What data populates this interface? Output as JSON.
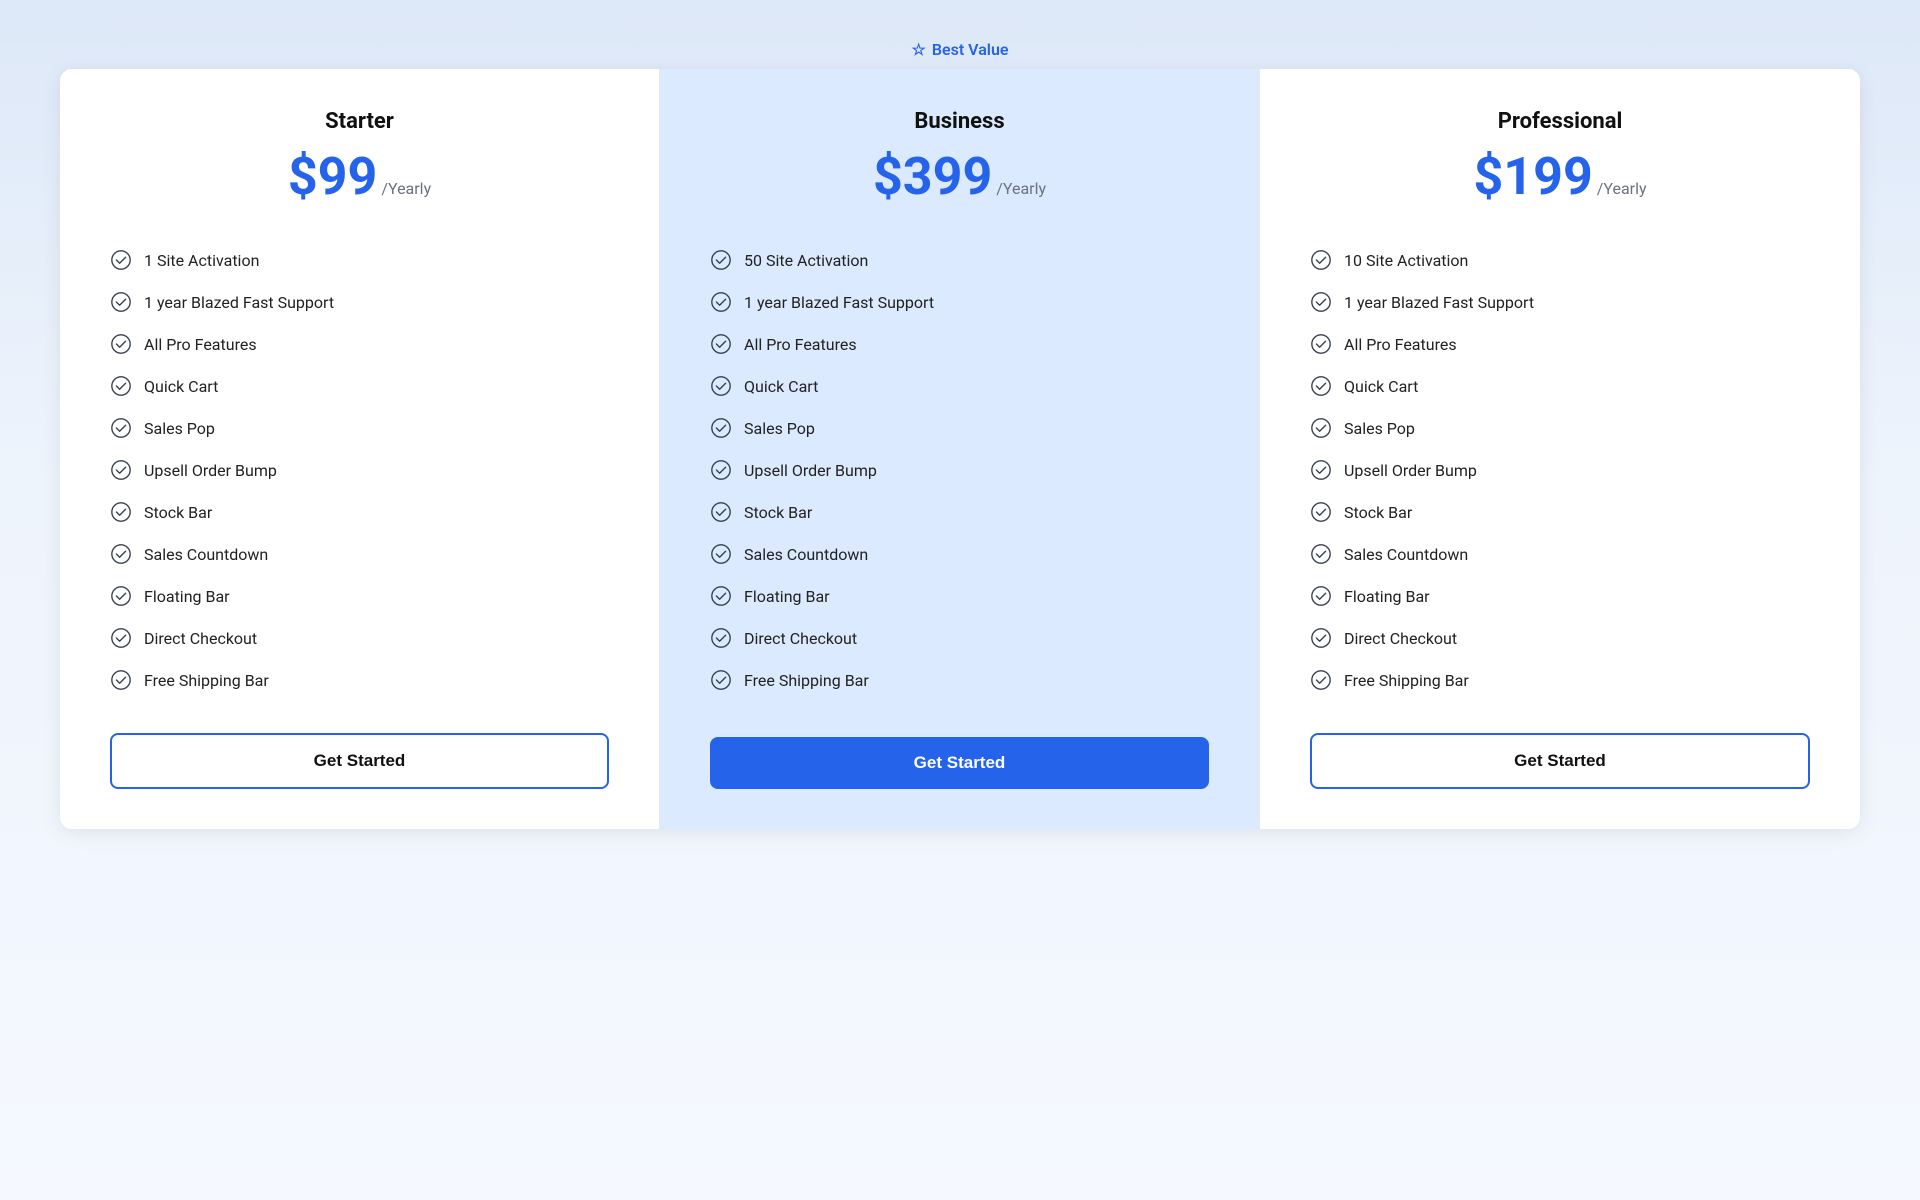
{
  "badge": {
    "label": "Best Value",
    "star": "☆"
  },
  "plans": [
    {
      "id": "starter",
      "name": "Starter",
      "price": "$99",
      "period": "/Yearly",
      "featured": false,
      "cta": "Get Started",
      "cta_style": "outline",
      "features": [
        "1 Site Activation",
        "1 year Blazed Fast Support",
        "All Pro Features",
        "Quick Cart",
        "Sales Pop",
        "Upsell Order Bump",
        "Stock Bar",
        "Sales Countdown",
        "Floating Bar",
        "Direct Checkout",
        "Free Shipping Bar"
      ]
    },
    {
      "id": "business",
      "name": "Business",
      "price": "$399",
      "period": "/Yearly",
      "featured": true,
      "cta": "Get Started",
      "cta_style": "filled",
      "features": [
        "50 Site Activation",
        "1 year Blazed Fast Support",
        "All Pro Features",
        "Quick Cart",
        "Sales Pop",
        "Upsell Order Bump",
        "Stock Bar",
        "Sales Countdown",
        "Floating Bar",
        "Direct Checkout",
        "Free Shipping Bar"
      ]
    },
    {
      "id": "professional",
      "name": "Professional",
      "price": "$199",
      "period": "/Yearly",
      "featured": false,
      "cta": "Get Started",
      "cta_style": "outline",
      "features": [
        "10 Site Activation",
        "1 year Blazed Fast Support",
        "All Pro Features",
        "Quick Cart",
        "Sales Pop",
        "Upsell Order Bump",
        "Stock Bar",
        "Sales Countdown",
        "Floating Bar",
        "Direct Checkout",
        "Free Shipping Bar"
      ]
    }
  ]
}
